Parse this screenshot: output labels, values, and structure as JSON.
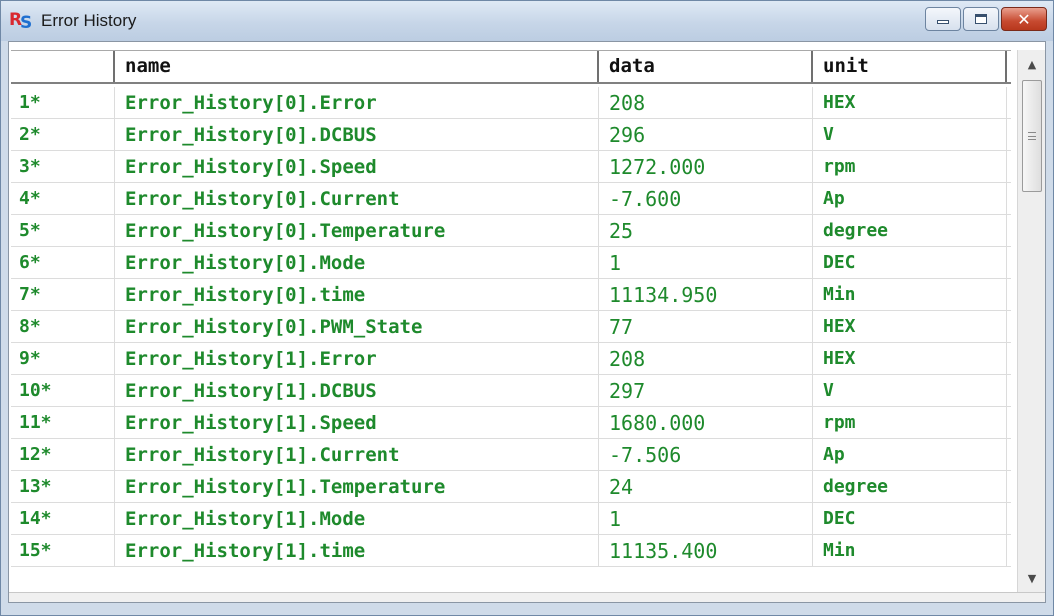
{
  "window": {
    "title": "Error History",
    "icon": "rs-app-icon",
    "minimize_icon": "minimize-icon",
    "maximize_icon": "maximize-icon",
    "close_icon": "close-icon"
  },
  "table": {
    "columns": [
      "name",
      "data",
      "unit"
    ],
    "rows": [
      {
        "idx": "1*",
        "name": "Error_History[0].Error",
        "data": "208",
        "unit": "HEX"
      },
      {
        "idx": "2*",
        "name": "Error_History[0].DCBUS",
        "data": "296",
        "unit": "V"
      },
      {
        "idx": "3*",
        "name": "Error_History[0].Speed",
        "data": "1272.000",
        "unit": "rpm"
      },
      {
        "idx": "4*",
        "name": "Error_History[0].Current",
        "data": "-7.600",
        "unit": "Ap"
      },
      {
        "idx": "5*",
        "name": "Error_History[0].Temperature",
        "data": "25",
        "unit": "degree"
      },
      {
        "idx": "6*",
        "name": "Error_History[0].Mode",
        "data": "1",
        "unit": "DEC"
      },
      {
        "idx": "7*",
        "name": "Error_History[0].time",
        "data": "11134.950",
        "unit": "Min"
      },
      {
        "idx": "8*",
        "name": "Error_History[0].PWM_State",
        "data": "77",
        "unit": "HEX"
      },
      {
        "idx": "9*",
        "name": "Error_History[1].Error",
        "data": "208",
        "unit": "HEX"
      },
      {
        "idx": "10*",
        "name": "Error_History[1].DCBUS",
        "data": "297",
        "unit": "V"
      },
      {
        "idx": "11*",
        "name": "Error_History[1].Speed",
        "data": "1680.000",
        "unit": "rpm"
      },
      {
        "idx": "12*",
        "name": "Error_History[1].Current",
        "data": "-7.506",
        "unit": "Ap"
      },
      {
        "idx": "13*",
        "name": "Error_History[1].Temperature",
        "data": "24",
        "unit": "degree"
      },
      {
        "idx": "14*",
        "name": "Error_History[1].Mode",
        "data": "1",
        "unit": "DEC"
      },
      {
        "idx": "15*",
        "name": "Error_History[1].time",
        "data": "11135.400",
        "unit": "Min"
      }
    ]
  },
  "colors": {
    "row_text": "#1e8a2c",
    "title_bar": "#c7d6e8",
    "close_button": "#c74a30"
  }
}
